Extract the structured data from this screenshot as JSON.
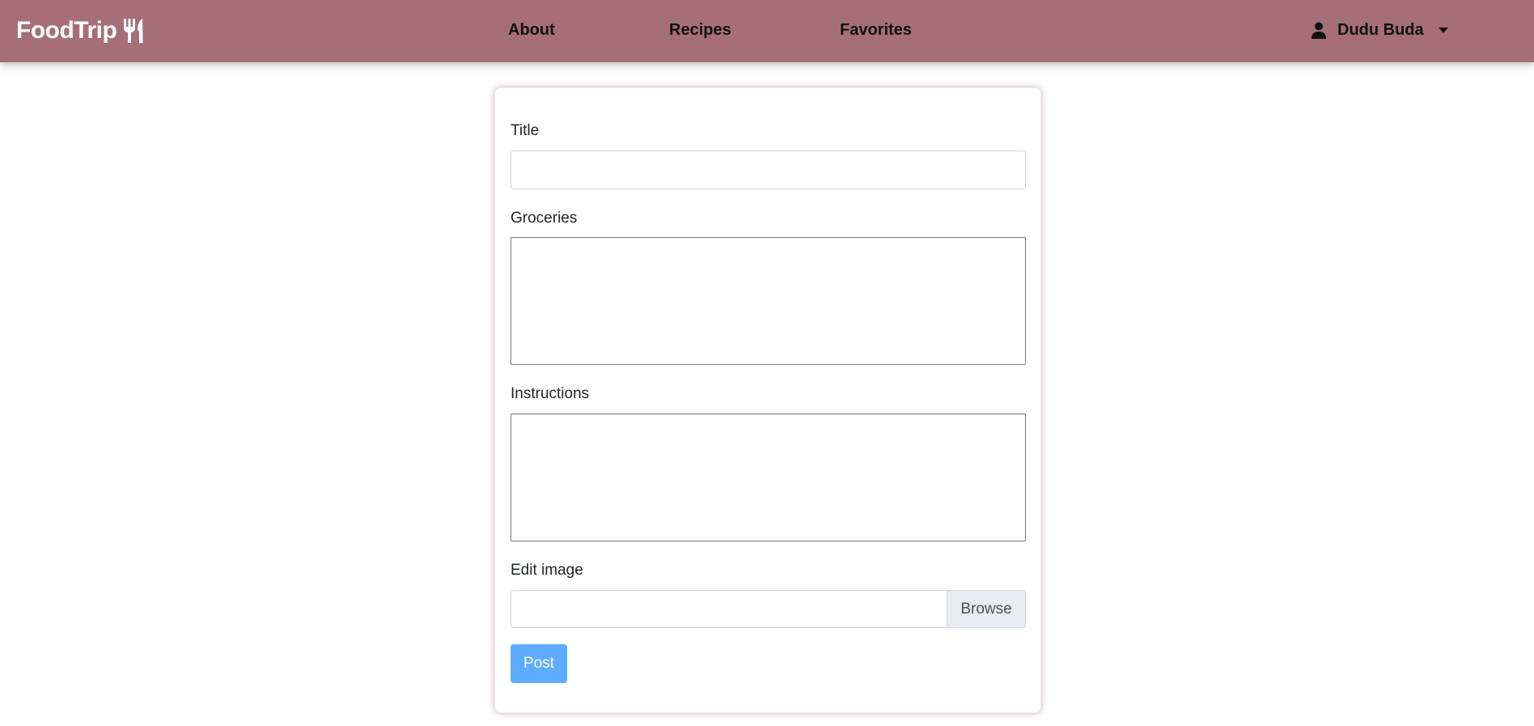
{
  "navbar": {
    "brand": "FoodTrip",
    "brand_icon": "utensils-icon",
    "links": [
      "About",
      "Recipes",
      "Favorites"
    ],
    "user_name": "Dudu Buda",
    "user_icon": "user-icon",
    "dropdown_icon": "caret-down-icon",
    "background_color": "#a66f78"
  },
  "form": {
    "title_label": "Title",
    "title_value": "",
    "groceries_label": "Groceries",
    "groceries_value": "",
    "instructions_label": "Instructions",
    "instructions_value": "",
    "image_label": "Edit image",
    "browse_label": "Browse",
    "submit_label": "Post",
    "submit_color": "#5cabff"
  }
}
